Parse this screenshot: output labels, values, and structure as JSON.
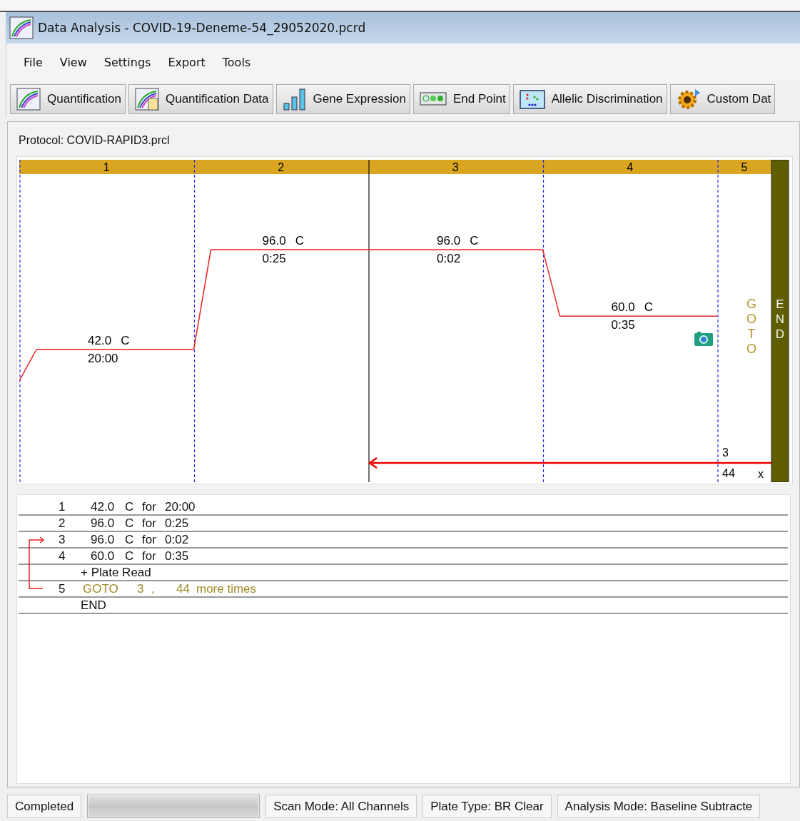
{
  "window": {
    "title": "Data Analysis - COVID-19-Deneme-54_29052020.pcrd"
  },
  "menu": [
    "File",
    "View",
    "Settings",
    "Export",
    "Tools"
  ],
  "toolbar": [
    {
      "label": "Quantification",
      "kind": "curve"
    },
    {
      "label": "Quantification Data",
      "kind": "curve-data"
    },
    {
      "label": "Gene Expression",
      "kind": "bars"
    },
    {
      "label": "End Point",
      "kind": "dots"
    },
    {
      "label": "Allelic Discrimination",
      "kind": "scatter"
    },
    {
      "label": "Custom Dat",
      "kind": "gear"
    }
  ],
  "protocol": {
    "label": "Protocol: COVID-RAPID3.prcl"
  },
  "chart": {
    "steps": [
      {
        "kind": "hold",
        "number": "1",
        "temp": "42.0",
        "unit": "C",
        "time": "20:00"
      },
      {
        "kind": "hold",
        "number": "2",
        "temp": "96.0",
        "unit": "C",
        "time": "0:25"
      },
      {
        "kind": "hold",
        "number": "3",
        "temp": "96.0",
        "unit": "C",
        "time": "0:02"
      },
      {
        "kind": "hold_read",
        "number": "4",
        "temp": "60.0",
        "unit": "C",
        "time": "0:35"
      },
      {
        "kind": "goto",
        "number": "5",
        "label": "GOTO",
        "target": "3",
        "repeats": "44",
        "times_mark": "x"
      }
    ],
    "end_label": "END"
  },
  "list": {
    "rows": [
      {
        "kind": "step",
        "number": "1",
        "temp": "42.0",
        "unit": "C",
        "for": "for",
        "time": "20:00"
      },
      {
        "kind": "step",
        "number": "2",
        "temp": "96.0",
        "unit": "C",
        "for": "for",
        "time": "0:25"
      },
      {
        "kind": "step",
        "number": "3",
        "temp": "96.0",
        "unit": "C",
        "for": "for",
        "time": "0:02"
      },
      {
        "kind": "step",
        "number": "4",
        "temp": "60.0",
        "unit": "C",
        "for": "for",
        "time": "0:35"
      },
      {
        "kind": "plate_read",
        "text": "+ Plate Read"
      },
      {
        "kind": "goto",
        "number": "5",
        "goto": "GOTO",
        "target": "3",
        "sep": ",",
        "repeats": "44",
        "suffix": "more times"
      },
      {
        "kind": "end",
        "text": "END"
      }
    ]
  },
  "status_bar": [
    {
      "kind": "text",
      "text": "Completed"
    },
    {
      "kind": "progress",
      "level": 1
    },
    {
      "kind": "text",
      "text": "Scan Mode: All Channels"
    },
    {
      "kind": "text",
      "text": "Plate Type: BR Clear"
    },
    {
      "kind": "text",
      "text": "Analysis Mode: Baseline Subtracte"
    }
  ]
}
